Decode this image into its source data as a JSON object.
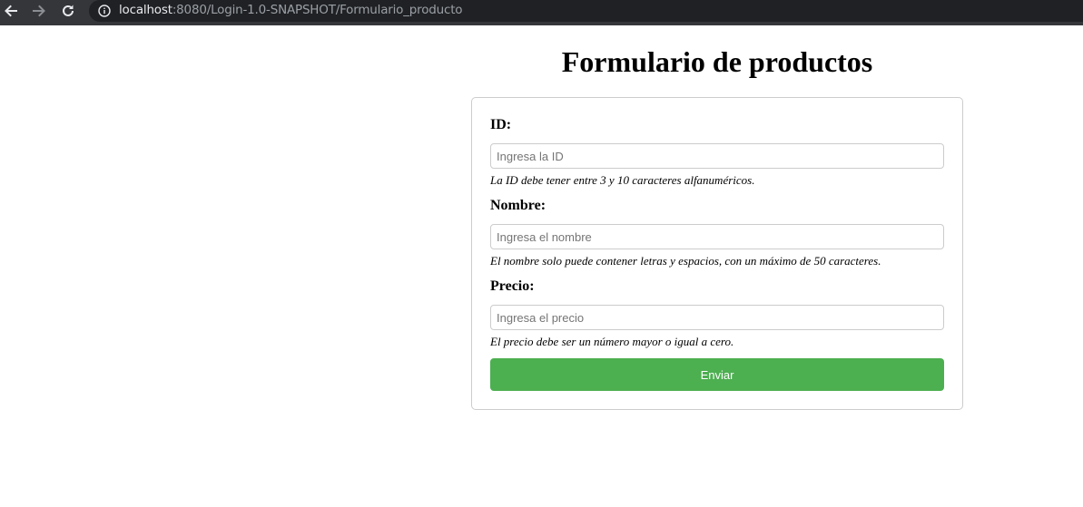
{
  "browser": {
    "url_host": "localhost",
    "url_rest": ":8080/Login-1.0-SNAPSHOT/Formulario_producto",
    "icons": {
      "back": "arrow-left-icon",
      "forward": "arrow-right-icon",
      "reload": "reload-icon",
      "info": "info-icon"
    }
  },
  "page": {
    "title": "Formulario de productos"
  },
  "form": {
    "fields": [
      {
        "label": "ID:",
        "placeholder": "Ingresa la ID",
        "value": "",
        "hint": "La ID debe tener entre 3 y 10 caracteres alfanuméricos."
      },
      {
        "label": "Nombre:",
        "placeholder": "Ingresa el nombre",
        "value": "",
        "hint": "El nombre solo puede contener letras y espacios, con un máximo de 50 caracteres."
      },
      {
        "label": "Precio:",
        "placeholder": "Ingresa el precio",
        "value": "",
        "hint": "El precio debe ser un número mayor o igual a cero."
      }
    ],
    "submit_label": "Enviar"
  },
  "colors": {
    "submit_button": "#4caf50",
    "browser_bar": "#35363a",
    "address_pill": "#202124"
  }
}
